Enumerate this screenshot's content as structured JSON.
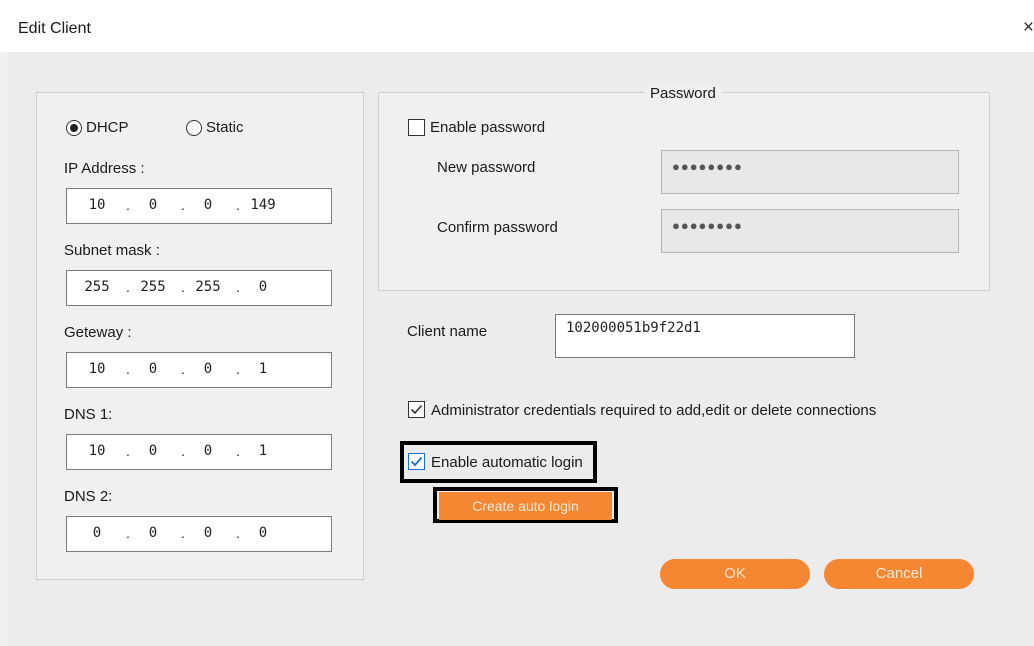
{
  "window": {
    "title": "Edit Client",
    "close_glyph": "×"
  },
  "network": {
    "dhcp_label": "DHCP",
    "static_label": "Static",
    "selected_mode": "DHCP",
    "fields": [
      {
        "label": "IP Address :",
        "octets": [
          "10",
          "0",
          "0",
          "149"
        ]
      },
      {
        "label": "Subnet mask :",
        "octets": [
          "255",
          "255",
          "255",
          "0"
        ]
      },
      {
        "label": "Geteway :",
        "octets": [
          "10",
          "0",
          "0",
          "1"
        ]
      },
      {
        "label": "DNS 1:",
        "octets": [
          "10",
          "0",
          "0",
          "1"
        ]
      },
      {
        "label": "DNS 2:",
        "octets": [
          "0",
          "0",
          "0",
          "0"
        ]
      }
    ]
  },
  "password": {
    "group_title": "Password",
    "enable_label": "Enable password",
    "enable_checked": false,
    "new_label": "New password",
    "new_value": "●●●●●●●●",
    "confirm_label": "Confirm password",
    "confirm_value": "●●●●●●●●"
  },
  "client": {
    "name_label": "Client name",
    "name_value": "102000051b9f22d1"
  },
  "options": {
    "admin_label": "Administrator credentials required to add,edit or delete connections",
    "admin_checked": true,
    "autologin_label": "Enable automatic login",
    "autologin_checked": true,
    "create_autologin_label": "Create auto login"
  },
  "buttons": {
    "ok": "OK",
    "cancel": "Cancel"
  },
  "colors": {
    "accent": "#f58732",
    "check_blue": "#1a6fd6"
  }
}
